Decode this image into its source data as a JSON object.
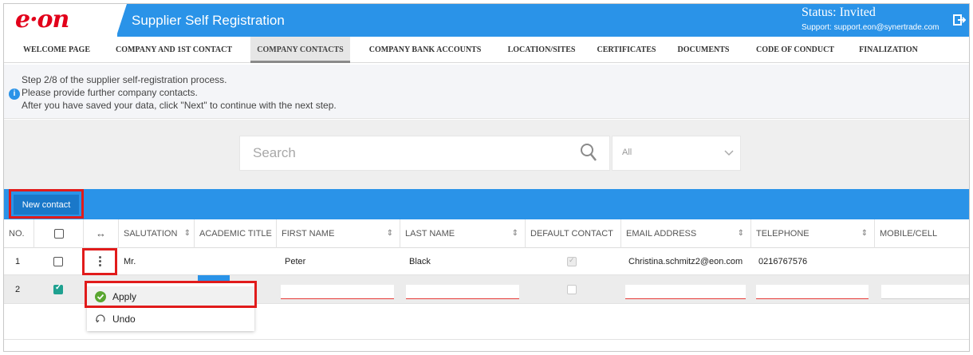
{
  "brand": {
    "logo_text": "e·on",
    "brand_color": "#e2001a",
    "accent_color": "#2a93e8"
  },
  "header": {
    "title": "Supplier Self Registration",
    "status": "Status: Invited",
    "support": "Support: support.eon@synertrade.com",
    "logout_icon": "logout-icon"
  },
  "tabs": [
    {
      "label": "WELCOME PAGE"
    },
    {
      "label": "COMPANY AND 1ST CONTACT"
    },
    {
      "label": "COMPANY CONTACTS"
    },
    {
      "label": "COMPANY BANK ACCOUNTS"
    },
    {
      "label": "LOCATION/SITES"
    },
    {
      "label": "CERTIFICATES"
    },
    {
      "label": "DOCUMENTS"
    },
    {
      "label": "CODE OF CONDUCT"
    },
    {
      "label": "FINALIZATION"
    }
  ],
  "active_tab": "COMPANY CONTACTS",
  "info": {
    "line1": "Step 2/8 of the supplier self-registration process.",
    "line2": "Please provide further company contacts.",
    "line3": "After you have saved your data, click \"Next\" to continue with the next step."
  },
  "search": {
    "placeholder": "Search",
    "filter_value": "All"
  },
  "toolbar": {
    "new_contact_label": "New contact"
  },
  "table": {
    "headers": {
      "no": "NO.",
      "resize": "↔",
      "salutation": "SALUTATION",
      "academic_title": "ACADEMIC TITLE",
      "first_name": "FIRST NAME",
      "last_name": "LAST NAME",
      "default_contact": "DEFAULT CONTACT",
      "email": "EMAIL ADDRESS",
      "telephone": "TELEPHONE",
      "mobile": "MOBILE/CELL"
    },
    "sort_glyph": "⇕",
    "rows": [
      {
        "no": "1",
        "selected": false,
        "salutation": "Mr.",
        "academic_title": "",
        "first_name": "Peter",
        "last_name": "Black",
        "default_contact": true,
        "email": "Christina.schmitz2@eon.com",
        "telephone": "0216767576",
        "mobile": ""
      },
      {
        "no": "2",
        "selected": true,
        "editing": true
      }
    ]
  },
  "row_menu": {
    "apply_label": "Apply",
    "undo_label": "Undo"
  }
}
